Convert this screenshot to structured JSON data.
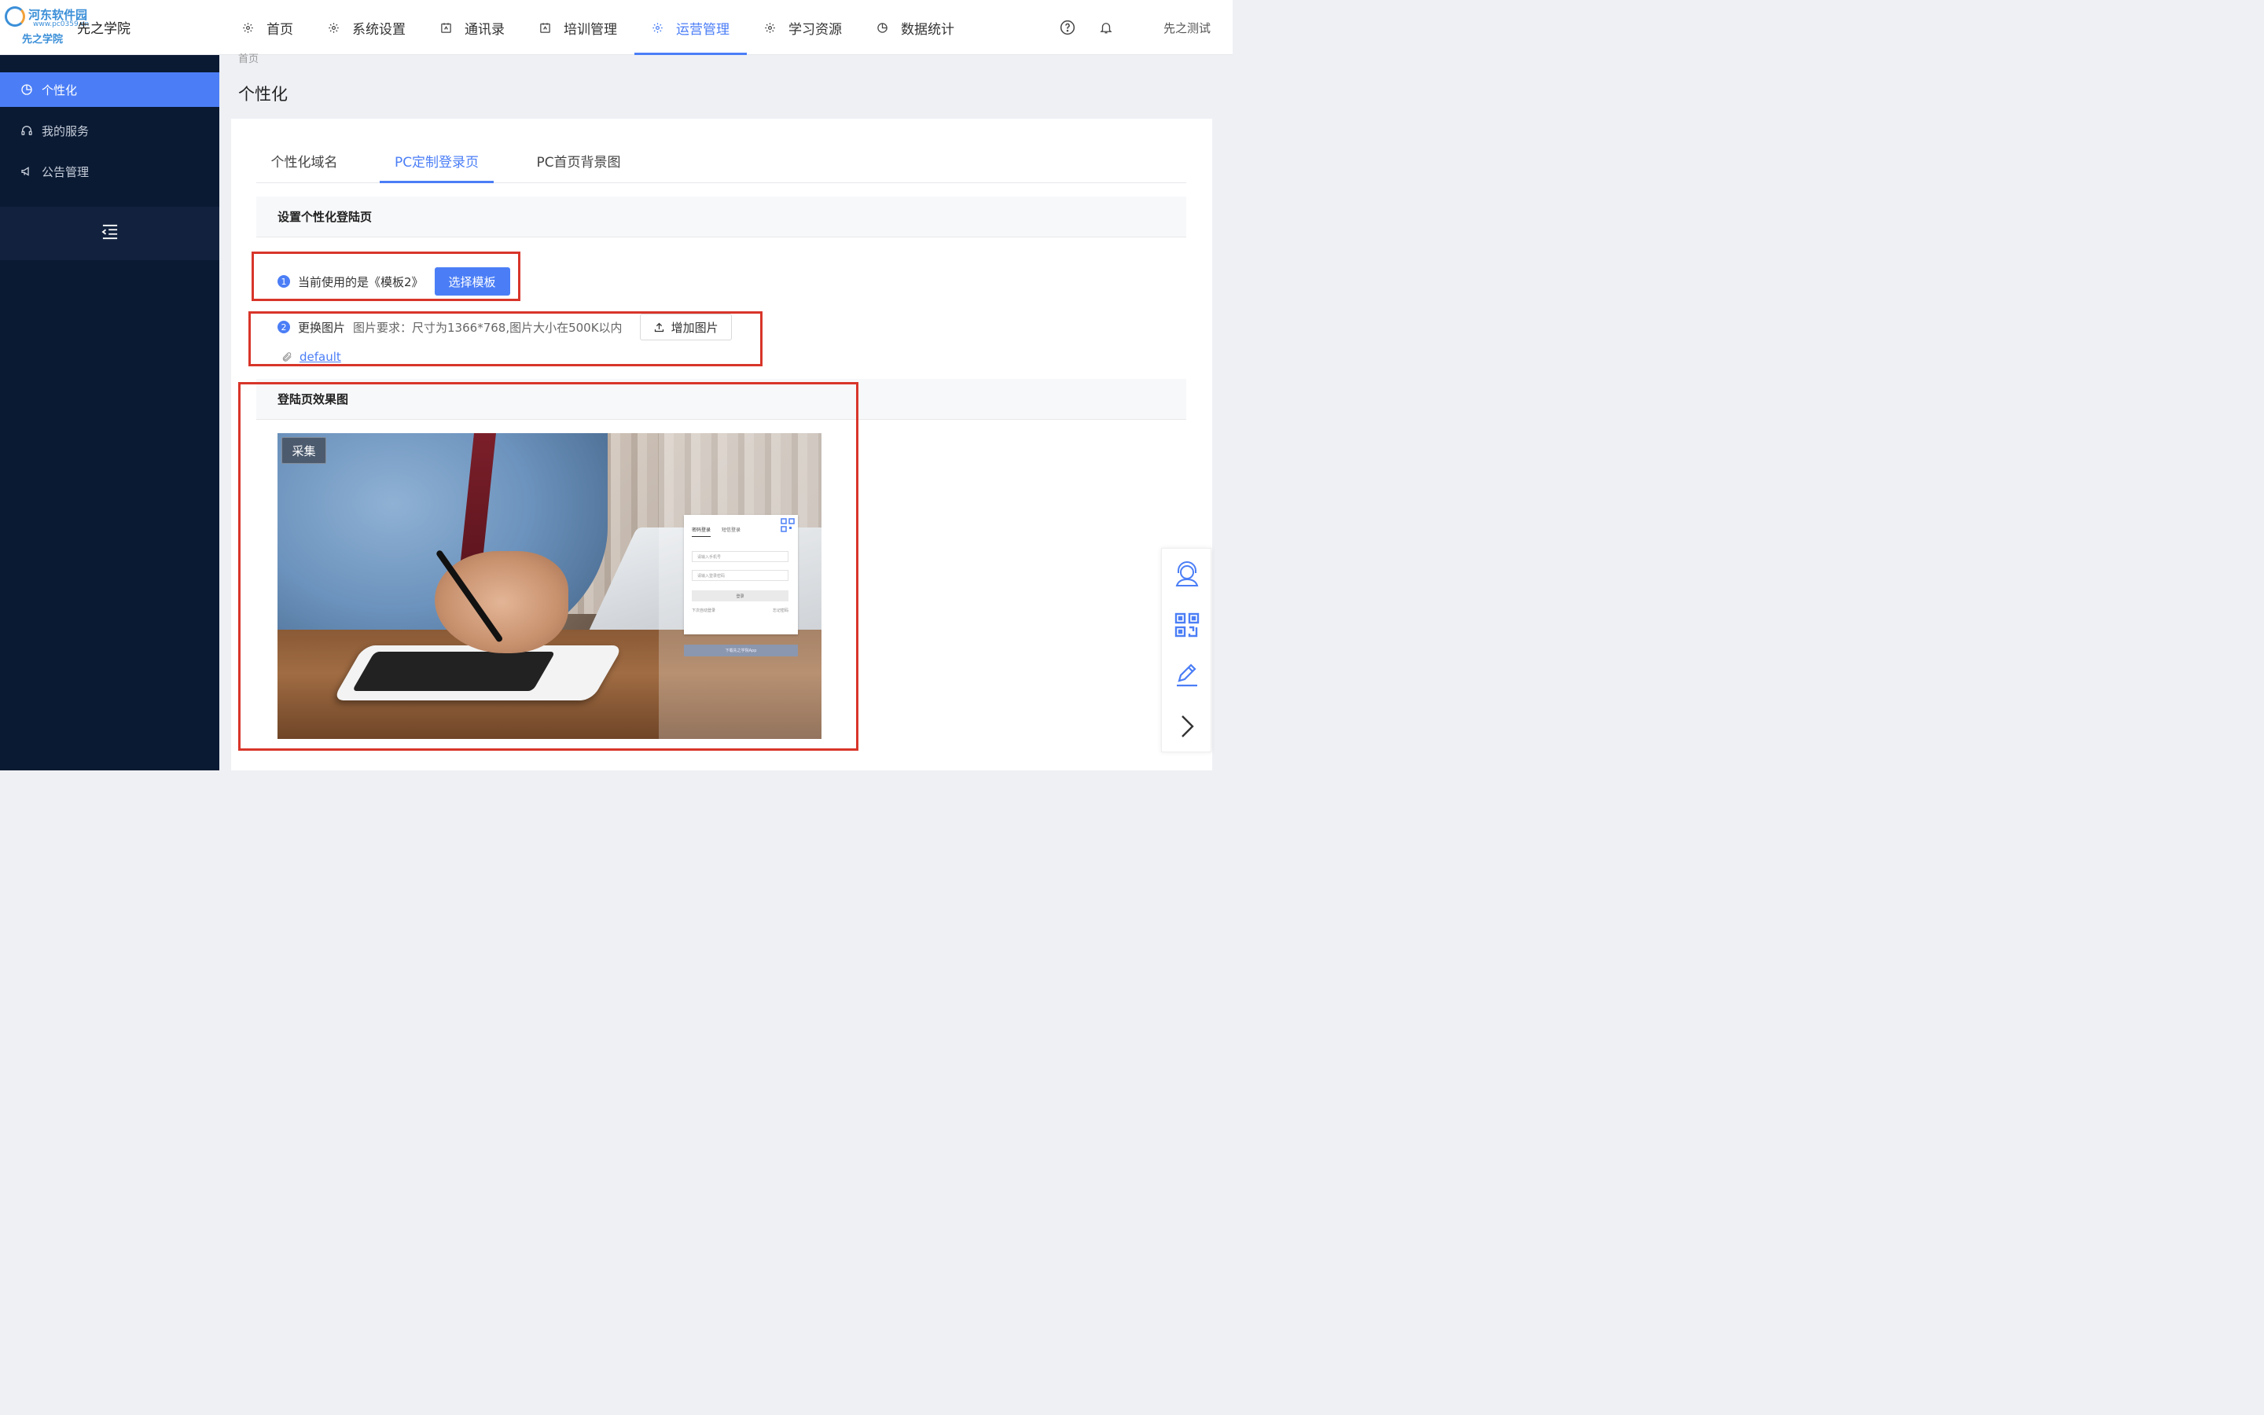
{
  "brand": {
    "watermark_line1": "河东软件园",
    "watermark_line2": "www.pc0359.cn",
    "watermark_line3": "先之学院",
    "app_name": "先之学院"
  },
  "nav": {
    "items": [
      {
        "label": "首页",
        "icon": "gear-icon"
      },
      {
        "label": "系统设置",
        "icon": "gear-icon"
      },
      {
        "label": "通讯录",
        "icon": "contacts-icon"
      },
      {
        "label": "培训管理",
        "icon": "contacts-icon"
      },
      {
        "label": "运营管理",
        "icon": "gear-icon",
        "active": true
      },
      {
        "label": "学习资源",
        "icon": "gear-icon"
      },
      {
        "label": "数据统计",
        "icon": "pie-chart-icon"
      }
    ],
    "help_icon": "help-icon",
    "bell_icon": "bell-icon",
    "user_name": "先之测试"
  },
  "sidebar": {
    "items": [
      {
        "label": "个性化",
        "icon": "pie-chart-icon",
        "active": true
      },
      {
        "label": "我的服务",
        "icon": "headset-icon"
      },
      {
        "label": "公告管理",
        "icon": "megaphone-icon"
      }
    ],
    "collapse_icon": "collapse-menu-icon"
  },
  "main": {
    "breadcrumb": "首页",
    "title": "个性化",
    "tabs": [
      {
        "label": "个性化域名"
      },
      {
        "label": "PC定制登录页",
        "active": true
      },
      {
        "label": "PC首页背景图"
      }
    ],
    "section1_title": "设置个性化登陆页",
    "step1": {
      "num": "1",
      "text": "当前使用的是《模板2》",
      "button": "选择模板"
    },
    "step2": {
      "num": "2",
      "label": "更换图片",
      "hint": "图片要求：尺寸为1366*768,图片大小在500K以内",
      "button": "增加图片",
      "file": "default"
    },
    "section2_title": "登陆页效果图",
    "preview": {
      "collect_label": "采集",
      "login_tab_pwd": "密码登录",
      "login_tab_sms": "短信登录",
      "phone_placeholder": "请输入手机号",
      "pwd_placeholder": "请输入登录密码",
      "login_button": "登录",
      "auto_login": "下次自动登录",
      "forgot": "忘记密码",
      "download_app": "下载先之学院App"
    }
  },
  "float_bar": {
    "icons": [
      "customer-service-icon",
      "qr-code-icon",
      "edit-icon",
      "chevron-right-icon"
    ]
  },
  "colors": {
    "accent": "#4b7ef6",
    "sidebar_bg": "#0a1a33",
    "highlight_box": "#d8352a"
  }
}
